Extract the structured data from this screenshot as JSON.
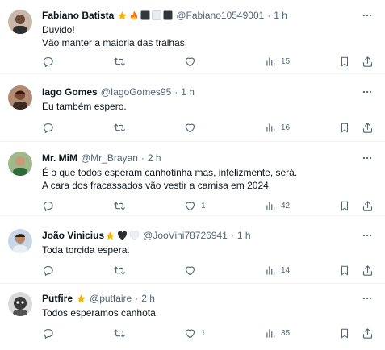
{
  "tweets": [
    {
      "name": "Fabiano Batista",
      "handle": "@Fabiano10549001",
      "separator": "·",
      "time": "1 h",
      "lines": [
        "Duvido!",
        "Vão manter a maioria das tralhas."
      ],
      "replies": "",
      "retweets": "",
      "likes": "",
      "views": "15",
      "emoji_names": [
        "star-emoji",
        "fire-emoji",
        "black-square-emoji",
        "white-square-emoji",
        "black-square-emoji"
      ],
      "avatar_color": "#6b4a3a"
    },
    {
      "name": "Iago Gomes",
      "handle": "@IagoGomes95",
      "separator": "·",
      "time": "1 h",
      "lines": [
        "Eu também espero."
      ],
      "replies": "",
      "retweets": "",
      "likes": "",
      "views": "16",
      "emoji_names": [],
      "avatar_color": "#8a5a44"
    },
    {
      "name": "Mr. MiM",
      "handle": "@Mr_Brayan",
      "separator": "·",
      "time": "2 h",
      "lines": [
        "É o que todos esperam canhotinha mas, infelizmente, será.",
        "A cara dos fracassados vão vestir a camisa em 2024."
      ],
      "replies": "",
      "retweets": "",
      "likes": "1",
      "views": "42",
      "emoji_names": [],
      "avatar_color": "#5a7a4a"
    },
    {
      "name": "João Vinicius",
      "handle": "@JooVini78726941",
      "separator": "·",
      "time": "1 h",
      "lines": [
        "Toda torcida espera."
      ],
      "replies": "",
      "retweets": "",
      "likes": "",
      "views": "14",
      "emoji_names": [
        "star-emoji",
        "black-heart-emoji",
        "white-heart-emoji"
      ],
      "avatar_color": "#7a8fa8"
    },
    {
      "name": "Putfire",
      "handle": "@putfaire",
      "separator": "·",
      "time": "2 h",
      "lines": [
        "Todos esperamos canhota"
      ],
      "replies": "",
      "retweets": "",
      "likes": "1",
      "views": "35",
      "emoji_names": [
        "star-emoji"
      ],
      "avatar_color": "#3a3a3a"
    }
  ],
  "colors": {
    "text": "#0f1419",
    "secondary": "#536471",
    "divider": "#eff3f4",
    "star": "#f4b400",
    "fire": "#ff6a00"
  }
}
